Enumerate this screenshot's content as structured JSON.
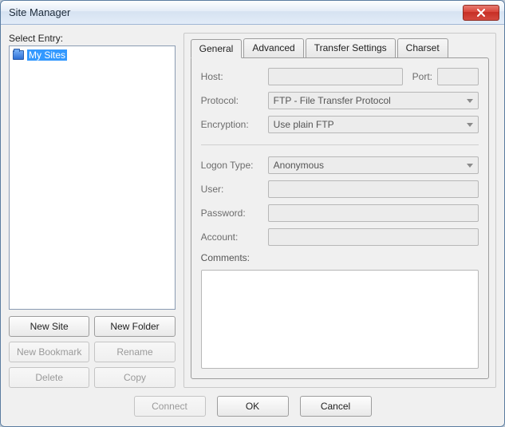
{
  "window": {
    "title": "Site Manager"
  },
  "left": {
    "select_label": "Select Entry:",
    "tree": {
      "root_label": "My Sites"
    },
    "buttons": {
      "new_site": "New Site",
      "new_folder": "New Folder",
      "new_bookmark": "New Bookmark",
      "rename": "Rename",
      "delete": "Delete",
      "copy": "Copy"
    }
  },
  "tabs": {
    "general": "General",
    "advanced": "Advanced",
    "transfer": "Transfer Settings",
    "charset": "Charset"
  },
  "general": {
    "host_label": "Host:",
    "host_value": "",
    "port_label": "Port:",
    "port_value": "",
    "protocol_label": "Protocol:",
    "protocol_value": "FTP - File Transfer Protocol",
    "encryption_label": "Encryption:",
    "encryption_value": "Use plain FTP",
    "logon_label": "Logon Type:",
    "logon_value": "Anonymous",
    "user_label": "User:",
    "user_value": "",
    "password_label": "Password:",
    "password_value": "",
    "account_label": "Account:",
    "account_value": "",
    "comments_label": "Comments:",
    "comments_value": ""
  },
  "footer": {
    "connect": "Connect",
    "ok": "OK",
    "cancel": "Cancel"
  }
}
